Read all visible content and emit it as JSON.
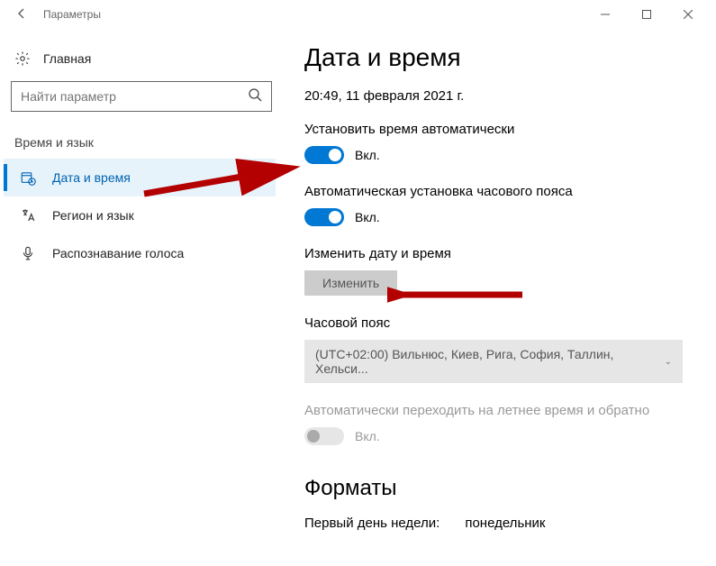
{
  "window": {
    "title": "Параметры"
  },
  "sidebar": {
    "home": "Главная",
    "search_placeholder": "Найти параметр",
    "section": "Время и язык",
    "items": [
      {
        "label": "Дата и время"
      },
      {
        "label": "Регион и язык"
      },
      {
        "label": "Распознавание голоса"
      }
    ]
  },
  "main": {
    "title": "Дата и время",
    "timestamp": "20:49, 11 февраля 2021 г.",
    "auto_time": {
      "label": "Установить время автоматически",
      "state": "Вкл."
    },
    "auto_tz": {
      "label": "Автоматическая установка часового пояса",
      "state": "Вкл."
    },
    "change": {
      "label": "Изменить дату и время",
      "button": "Изменить"
    },
    "timezone": {
      "label": "Часовой пояс",
      "value": "(UTC+02:00) Вильнюс, Киев, Рига, София, Таллин, Хельси..."
    },
    "dst": {
      "label": "Автоматически переходить на летнее время и обратно",
      "state": "Вкл."
    },
    "formats": {
      "title": "Форматы",
      "first_day_label": "Первый день недели:",
      "first_day_value": "понедельник"
    }
  }
}
